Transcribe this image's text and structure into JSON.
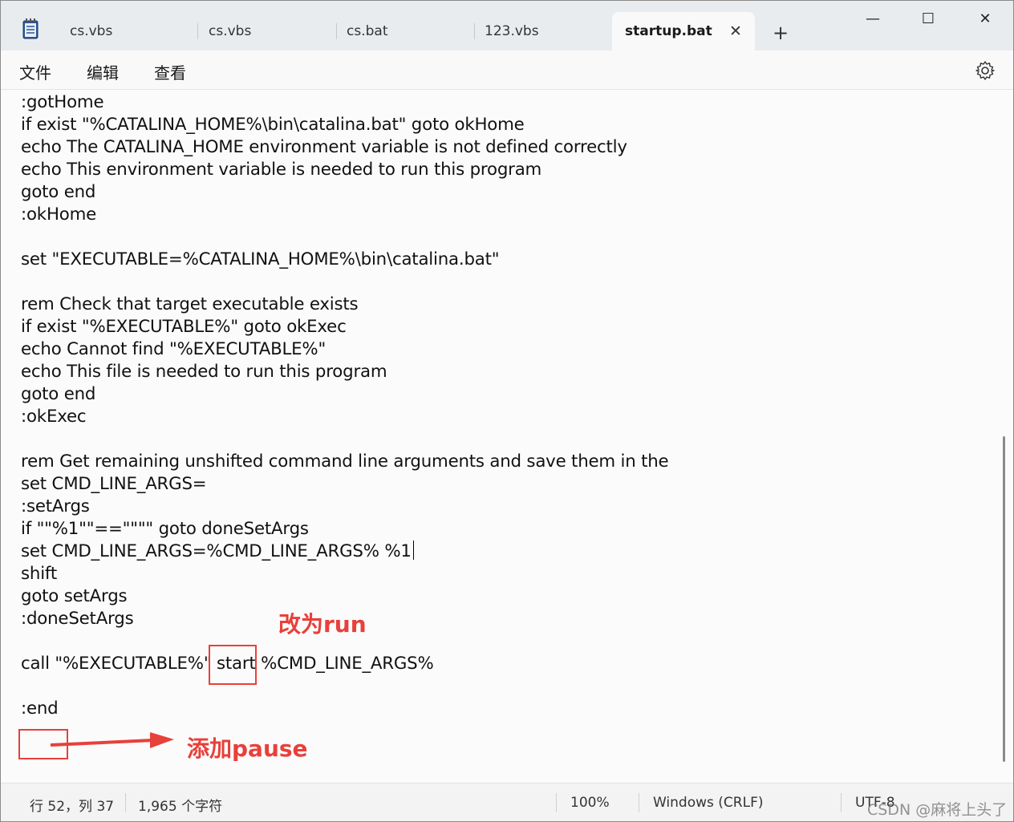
{
  "tabs": [
    {
      "label": "cs.vbs",
      "active": false
    },
    {
      "label": "cs.vbs",
      "active": false
    },
    {
      "label": "cs.bat",
      "active": false
    },
    {
      "label": "123.vbs",
      "active": false
    },
    {
      "label": "startup.bat",
      "active": true
    }
  ],
  "tab_close_glyph": "✕",
  "new_tab_glyph": "+",
  "window_controls": {
    "minimize": "—",
    "maximize": "☐",
    "close": "✕"
  },
  "menu": {
    "file": "文件",
    "edit": "编辑",
    "view": "查看"
  },
  "editor": {
    "lines": [
      ":gotHome",
      "if exist \"%CATALINA_HOME%\\bin\\catalina.bat\" goto okHome",
      "echo The CATALINA_HOME environment variable is not defined correctly",
      "echo This environment variable is needed to run this program",
      "goto end",
      ":okHome",
      "",
      "set \"EXECUTABLE=%CATALINA_HOME%\\bin\\catalina.bat\"",
      "",
      "rem Check that target executable exists",
      "if exist \"%EXECUTABLE%\" goto okExec",
      "echo Cannot find \"%EXECUTABLE%\"",
      "echo This file is needed to run this program",
      "goto end",
      ":okExec",
      "",
      "rem Get remaining unshifted command line arguments and save them in the",
      "set CMD_LINE_ARGS=",
      ":setArgs",
      "if \"\"%1\"\"==\"\"\"\" goto doneSetArgs",
      "set CMD_LINE_ARGS=%CMD_LINE_ARGS% %1",
      "shift",
      "goto setArgs",
      ":doneSetArgs",
      "",
      "call \"%EXECUTABLE%\" start %CMD_LINE_ARGS%",
      "",
      ":end",
      ""
    ]
  },
  "annotations": {
    "change_to_run": "改为run",
    "add_pause": "添加pause",
    "color": "#e8403a"
  },
  "status": {
    "position": "行 52，列 37",
    "char_count": "1,965 个字符",
    "zoom": "100%",
    "line_ending": "Windows (CRLF)",
    "encoding": "UTF-8"
  },
  "watermark": "CSDN @麻将上头了"
}
